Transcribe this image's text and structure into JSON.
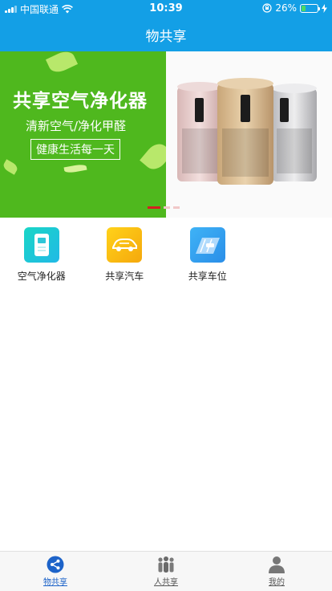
{
  "status_bar": {
    "carrier": "中国联通",
    "time": "10:39",
    "battery_percent": "26%",
    "battery_level": 0.26,
    "battery_color": "#4cd964"
  },
  "header": {
    "title": "物共享",
    "background": "#139fe6"
  },
  "banner": {
    "slide_text": {
      "headline": "共享空气净化器",
      "subline": "清新空气/净化甲醛",
      "boxed": "健康生活每一天"
    },
    "page_count": 3,
    "active_page": 1,
    "indicator_color": "#d42020"
  },
  "services": [
    {
      "label": "空气净化器",
      "icon": "air-purifier-icon"
    },
    {
      "label": "共享汽车",
      "icon": "car-icon"
    },
    {
      "label": "共享车位",
      "icon": "parking-space-icon"
    }
  ],
  "tabbar": {
    "active_color": "#1d63c9",
    "tabs": [
      {
        "label": "物共享",
        "icon": "share-icon",
        "active": true
      },
      {
        "label": "人共享",
        "icon": "people-icon",
        "active": false
      },
      {
        "label": "我的",
        "icon": "person-icon",
        "active": false
      }
    ]
  }
}
